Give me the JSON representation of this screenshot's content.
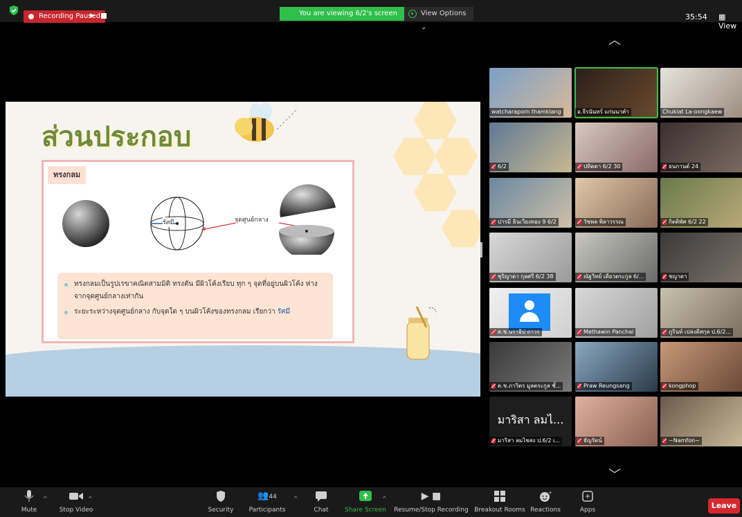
{
  "top_bar": {
    "recording_status": "Recording Paused",
    "viewing_banner": "You are viewing 6/2's screen",
    "view_options": "View Options ⌄",
    "timer": "35:54",
    "view_button": "View"
  },
  "slide": {
    "title": "ส่วนประกอบ",
    "tab_label": "ทรงกลม",
    "radius_label": "รัศมี",
    "center_label": "จุดศูนย์กลาง",
    "bullet_1": "ทรงกลมเป็นรูปเรขาคณิตสามมิติ ทรงตัน มีผิวโค้งเรียบ ทุก ๆ จุดที่อยู่บนผิวโค้ง ห่างจากจุดศูนย์กลางเท่ากัน",
    "bullet_2_prefix": "ระยะระหว่างจุดศูนย์กลาง กับจุดใด ๆ บนผิวโค้งของทรงกลม เรียกว่า ",
    "bullet_2_highlight": "รัศมี"
  },
  "participants": [
    {
      "name": "watcharaporn thamklang",
      "muted": false
    },
    {
      "name": "อ.จีรนันทร์ แก่นนาคำ",
      "muted": false
    },
    {
      "name": "Chukiat La-oongkaew",
      "muted": false
    },
    {
      "name": "6/2",
      "muted": true
    },
    {
      "name": "ปทิตตา 6/2  30",
      "muted": true
    },
    {
      "name": "ธนกานต์ 24",
      "muted": true
    },
    {
      "name": "ปารมี ธินเวียงทอง 9 6/2",
      "muted": true
    },
    {
      "name": "วัชพล พิลาวรรณ",
      "muted": true
    },
    {
      "name": "กิตติพัศ 6/2 22",
      "muted": true
    },
    {
      "name": "ชุริญาดา กุลศรี 6/2 38",
      "muted": true
    },
    {
      "name": "ณัฐวิทย์ เดียวตระกูล 6/...",
      "muted": true
    },
    {
      "name": "ชญาดา",
      "muted": true
    },
    {
      "name": "ด.ช.นราธิป ถาวร",
      "muted": true
    },
    {
      "name": "Methawin Panchai",
      "muted": true
    },
    {
      "name": "ภูรินท์ เปล่งดีสกุล ป.6/2...",
      "muted": true
    },
    {
      "name": "ด.ช.ภาวิตร มูลตระกูล ชั้...",
      "muted": true
    },
    {
      "name": "Praw Reungsang",
      "muted": true
    },
    {
      "name": "kongphop",
      "muted": true
    },
    {
      "name": "มาริสา ลมไชสง ป.6/2 เ...",
      "muted": true,
      "big_name": "มาริสา ลมไ..."
    },
    {
      "name": "ธัญรัตน์",
      "muted": true
    },
    {
      "name": "~Namfon~",
      "muted": true
    }
  ],
  "toolbar": {
    "mute": "Mute",
    "stop_video": "Stop Video",
    "security": "Security",
    "participants": "Participants",
    "participant_count": "44",
    "chat": "Chat",
    "share_screen": "Share Screen",
    "resume_stop_recording": "Resume/Stop Recording",
    "breakout_rooms": "Breakout Rooms",
    "reactions": "Reactions",
    "apps": "Apps",
    "leave": "Leave"
  },
  "colors": {
    "accent_green": "#2fbf4a",
    "recording_red": "#c8262e",
    "leave_red": "#d7272e",
    "title_green": "#6f8a3c"
  }
}
